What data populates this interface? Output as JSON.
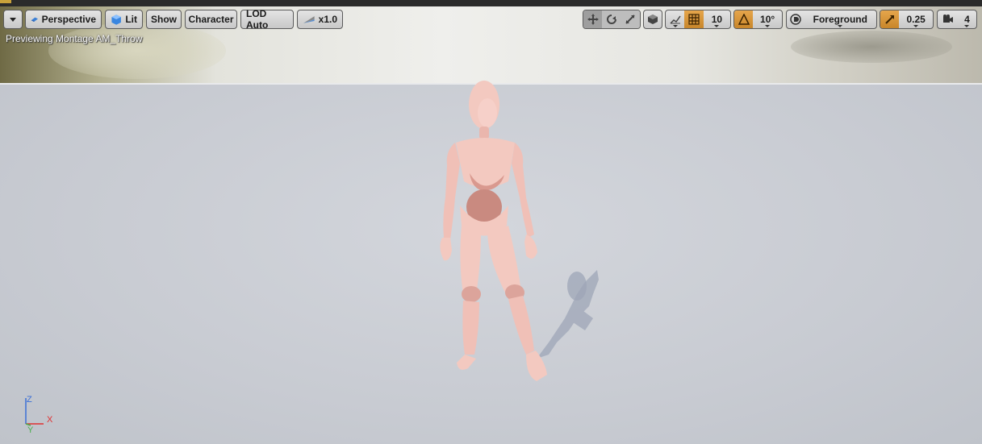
{
  "toolbar": {
    "menu_label": "",
    "perspective_label": "Perspective",
    "lit_label": "Lit",
    "show_label": "Show",
    "character_label": "Character",
    "lod_label": "LOD Auto",
    "speed_label": "x1.0",
    "grid_snap_value": "10",
    "rotation_snap_value": "10°",
    "layer_label": "Foreground",
    "scale_snap_value": "0.25",
    "camera_speed_value": "4"
  },
  "status": {
    "preview_text": "Previewing Montage AM_Throw"
  },
  "axis": {
    "z_label": "Z",
    "y_label": "Y",
    "x_label": "X",
    "colors": {
      "z": "#3b6fd6",
      "y": "#4caf50",
      "x": "#e03030"
    }
  },
  "colors": {
    "accent_orange": "#d9962f",
    "mannequin": "#f3c9c0"
  },
  "icons": {
    "dropdown": "chevron-down-icon",
    "perspective": "perspective-cube-icon",
    "lit": "lit-sphere-icon",
    "speed": "play-speed-icon",
    "translate": "translate-icon",
    "rotate": "rotate-icon",
    "scale": "scale-icon",
    "surface_snap": "surface-snap-icon",
    "grid": "grid-icon",
    "angle": "angle-snap-icon",
    "layer": "layer-icon",
    "scale_snap": "scale-snap-icon",
    "camera": "camera-speed-icon"
  }
}
